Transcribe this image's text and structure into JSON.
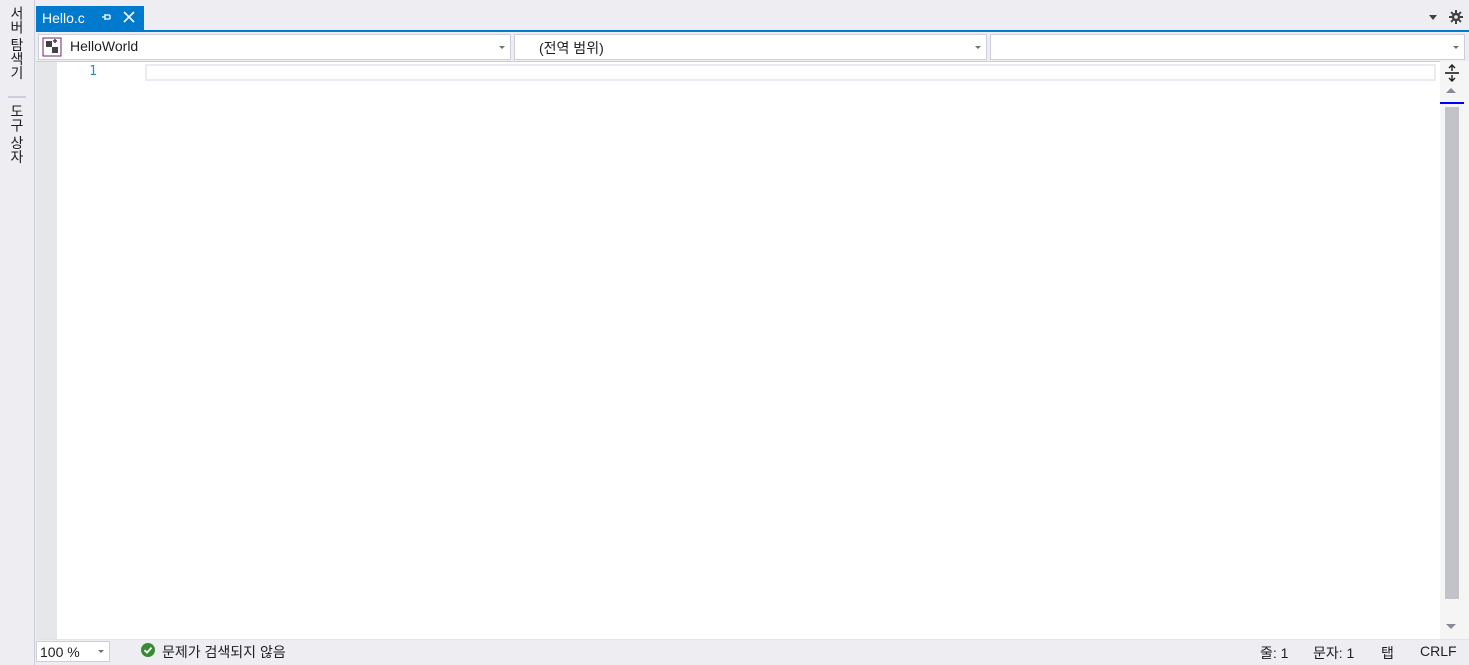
{
  "side_panel": {
    "server_explorer": "서버 탐색기",
    "toolbox": "도구 상자"
  },
  "document_tab": {
    "title": "Hello.c",
    "pin_icon": "pin-icon",
    "close_icon": "close-icon"
  },
  "window_controls": {
    "dropdown_icon": "chevron-down-icon",
    "settings_icon": "gear-icon"
  },
  "navigation_bar": {
    "project": "HelloWorld",
    "scope": "(전역 범위)",
    "member": ""
  },
  "editor": {
    "line_numbers": [
      "1"
    ],
    "lines": [
      ""
    ]
  },
  "status_bar": {
    "zoom": "100 %",
    "issues": "문제가 검색되지 않음",
    "line": "줄: 1",
    "column": "문자: 1",
    "indent": "탭",
    "line_ending": "CRLF"
  },
  "colors": {
    "accent": "#007acc",
    "background": "#eeeef2",
    "editor_background": "#ffffff",
    "line_number": "#2b91af",
    "success": "#388a34"
  }
}
